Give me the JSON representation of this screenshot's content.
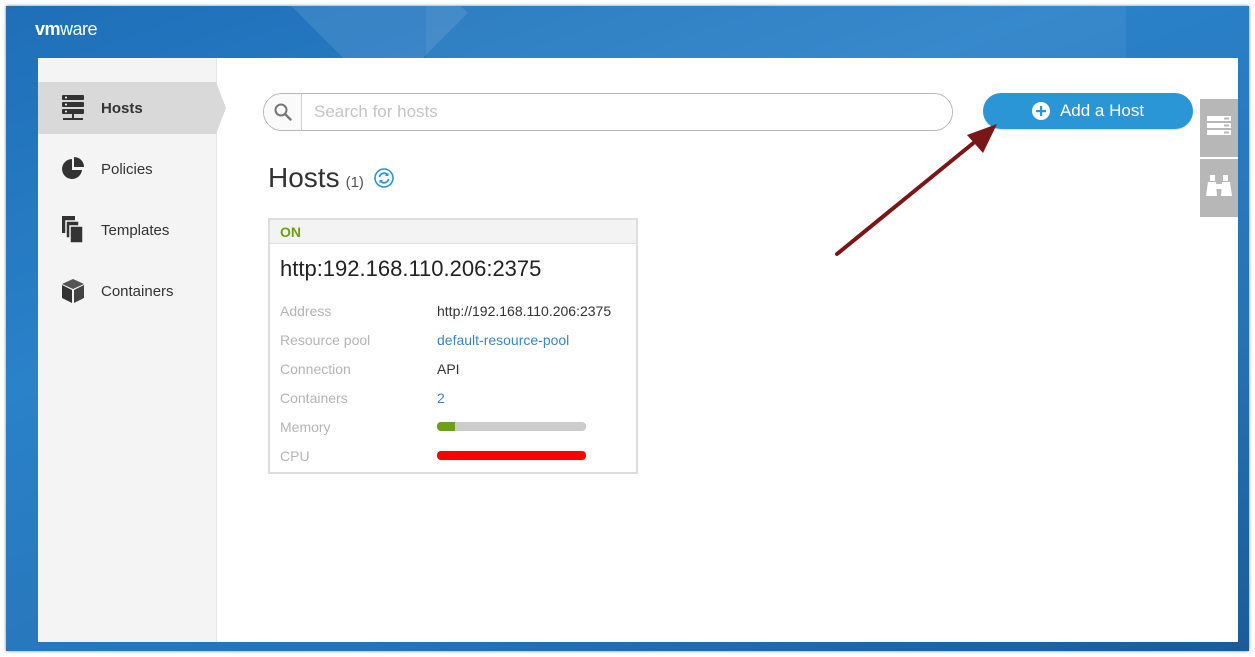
{
  "brand": {
    "prefix": "vm",
    "suffix": "ware"
  },
  "sidebar": {
    "items": [
      {
        "label": "Hosts",
        "icon": "hosts-icon",
        "active": true
      },
      {
        "label": "Policies",
        "icon": "pie-chart-icon",
        "active": false
      },
      {
        "label": "Templates",
        "icon": "templates-icon",
        "active": false
      },
      {
        "label": "Containers",
        "icon": "container-box-icon",
        "active": false
      }
    ]
  },
  "search": {
    "placeholder": "Search for hosts",
    "value": ""
  },
  "add_button": {
    "label": "Add a Host"
  },
  "header": {
    "title": "Hosts",
    "count": "(1)"
  },
  "host_card": {
    "status": "ON",
    "title": "http:192.168.110.206:2375",
    "properties": {
      "address": {
        "label": "Address",
        "value": "http://192.168.110.206:2375"
      },
      "resource_pool": {
        "label": "Resource pool",
        "value": "default-resource-pool"
      },
      "connection": {
        "label": "Connection",
        "value": "API"
      },
      "containers": {
        "label": "Containers",
        "value": "2"
      },
      "memory": {
        "label": "Memory",
        "usage_percent": 12
      },
      "cpu": {
        "label": "CPU",
        "usage_percent": 100
      }
    }
  },
  "colors": {
    "accent": "#2a96d6",
    "status_on": "#6ba10f",
    "memory_bar": "#6ba10f",
    "cpu_bar": "#ff0000",
    "annotation_arrow": "#7a1616"
  }
}
